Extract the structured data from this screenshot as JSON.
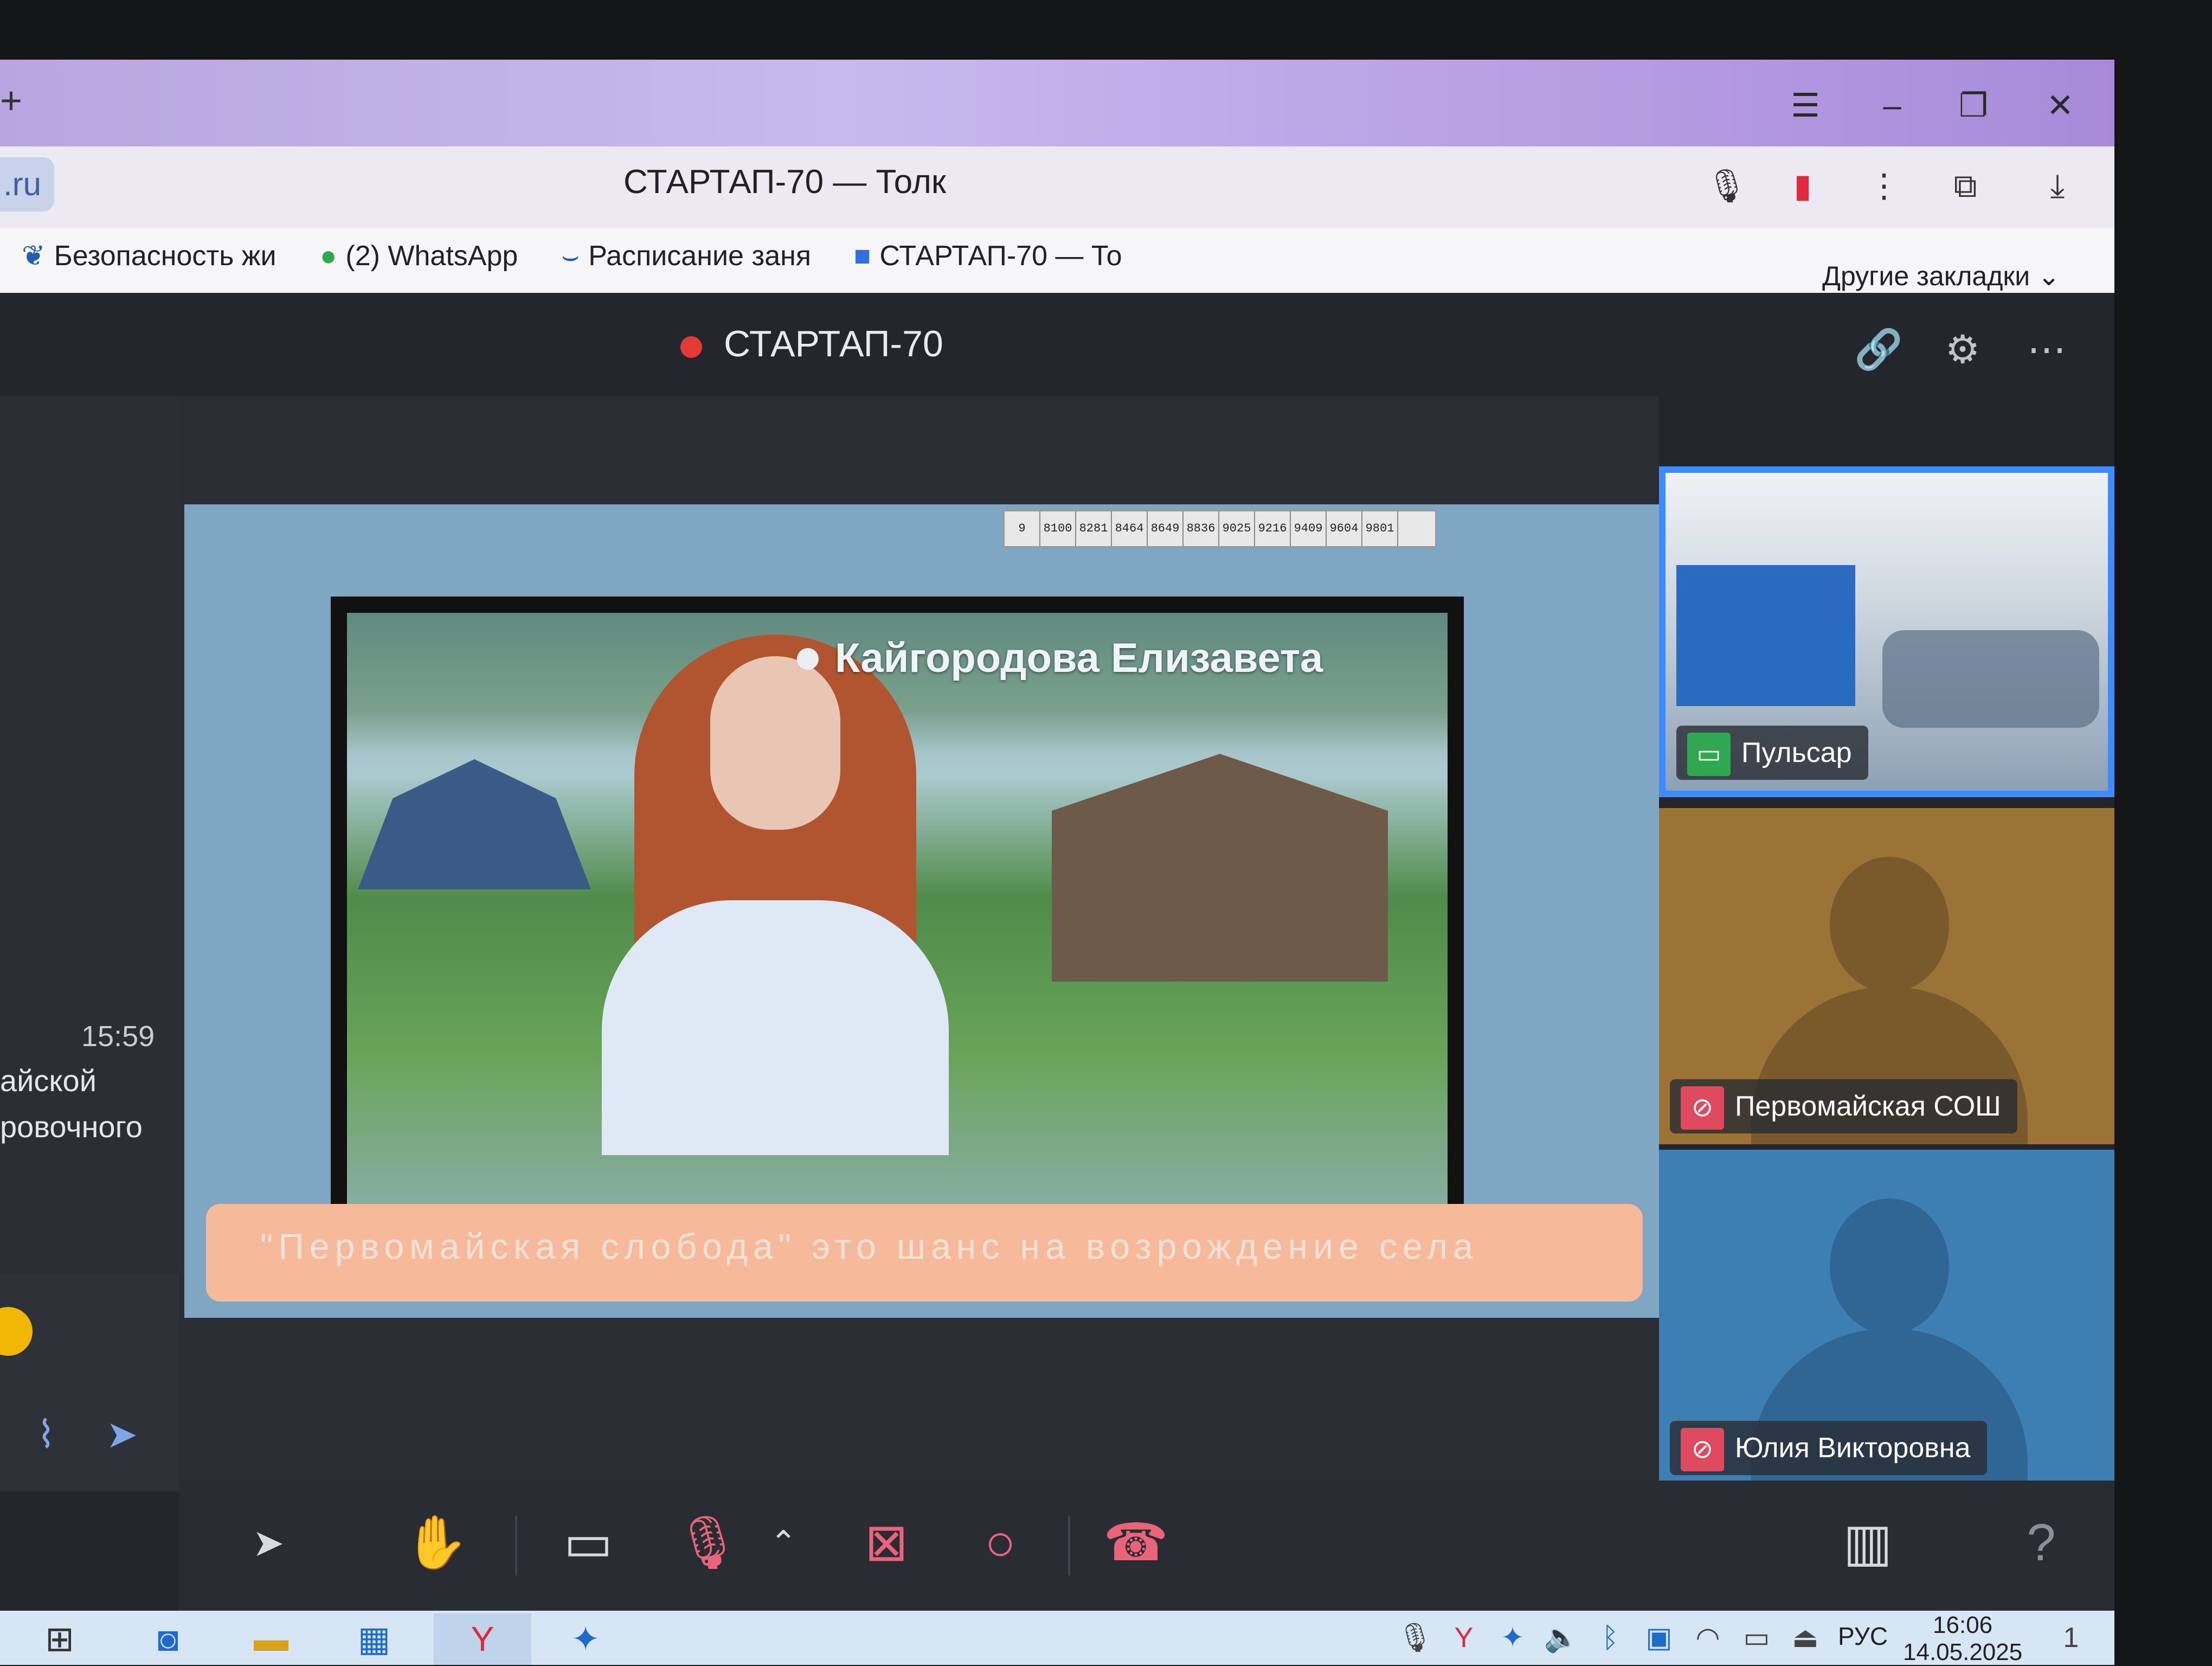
{
  "browser": {
    "new_tab_icon": "plus-icon",
    "url_fragment": ".ru",
    "title": "СТАРТАП-70 — Толк",
    "bookmarks": [
      {
        "icon": "shield-icon",
        "label": "Безопасность жи"
      },
      {
        "icon": "whatsapp-icon",
        "label": "(2) WhatsApp"
      },
      {
        "icon": "calendar-icon",
        "label": "Расписание заня"
      },
      {
        "icon": "camera-icon",
        "label": "СТАРТАП-70 — То"
      }
    ],
    "other_bookmarks": "Другие закладки"
  },
  "meeting": {
    "title": "СТАРТАП-70",
    "recording_color": "#e53935",
    "accent_color": "#3c8cff"
  },
  "chat": {
    "time": "15:59",
    "line1": "айской",
    "line2": "ровочного"
  },
  "video": {
    "wall_numbers": [
      "9",
      "8100",
      "8281",
      "8464",
      "8649",
      "8836",
      "9025",
      "9216",
      "9409",
      "9604",
      "9801"
    ],
    "speaker_name": "Кайгородова Елизавета",
    "caption": "\"Первомайская слобода\" это шанс на возрождение села"
  },
  "participants": [
    {
      "name": "Пульсар",
      "status_icon": "screen-share-icon",
      "active": true
    },
    {
      "name": "Первомайская СОШ",
      "status_icon": "mic-muted-icon",
      "active": false
    },
    {
      "name": "Юлия Викторовна",
      "status_icon": "mic-muted-icon",
      "active": false
    }
  ],
  "toolbar": {
    "icons": [
      "cursor-icon",
      "raise-hand-icon",
      "screen-share-icon",
      "mic-muted-icon",
      "chevron-up-icon",
      "camera-off-icon",
      "record-icon",
      "end-call-icon",
      "layout-icon",
      "help-icon"
    ]
  },
  "taskbar": {
    "language": "РУС",
    "time": "16:06",
    "date": "14.05.2025",
    "notifications": "1"
  }
}
